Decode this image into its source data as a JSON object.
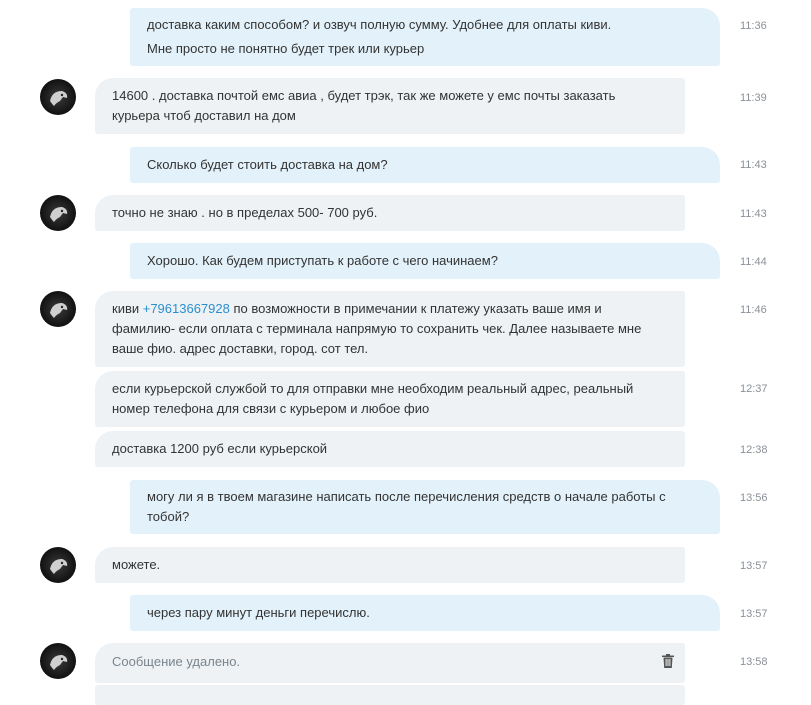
{
  "messages": [
    {
      "id": "m1",
      "dir": "out",
      "lines": [
        "доставка каким способом? и озвуч полную сумму. Удобнее для оплаты киви.",
        "Мне просто не понятно будет трек или курьер"
      ],
      "time": "11:36"
    },
    {
      "id": "m2",
      "dir": "in",
      "lines": [
        "14600 . доставка  почтой емс авиа , будет трэк, так же можете у емс почты заказать",
        "курьера чтоб доставил на дом"
      ],
      "time": "11:39"
    },
    {
      "id": "m3",
      "dir": "out",
      "lines": [
        "Сколько будет стоить доставка на дом?"
      ],
      "time": "11:43"
    },
    {
      "id": "m4",
      "dir": "in",
      "lines": [
        "точно не знаю . но в пределах  500- 700 руб."
      ],
      "time": "11:43"
    },
    {
      "id": "m5",
      "dir": "out",
      "lines": [
        "Хорошо. Как будем приступать к работе с чего начинаем?"
      ],
      "time": "11:44"
    },
    {
      "id": "m6",
      "dir": "in",
      "line1_prefix": "киви ",
      "phone": "+79613667928",
      "line1_suffix": "  по возможности в примечании к платежу указать ваше имя и",
      "lines": [
        "фамилию- если оплата с терминала напрямую то сохранить чек. Далее называете мне",
        "ваше фио. адрес доставки, город. сот тел."
      ],
      "time": "11:46"
    },
    {
      "id": "m7",
      "dir": "in",
      "lines": [
        "если курьерской службой то для отправки мне необходим реальный адрес, реальный",
        "номер телефона для связи с курьером и любое фио"
      ],
      "time": "12:37"
    },
    {
      "id": "m8",
      "dir": "in",
      "lines": [
        "доставка 1200 руб если курьерской"
      ],
      "time": "12:38"
    },
    {
      "id": "m9",
      "dir": "out",
      "lines": [
        "могу ли я в твоем магазине написать после перечисления средств о начале работы с",
        "тобой?"
      ],
      "time": "13:56"
    },
    {
      "id": "m10",
      "dir": "in",
      "lines": [
        "можете."
      ],
      "time": "13:57"
    },
    {
      "id": "m11",
      "dir": "out",
      "lines": [
        "через пару минут деньги перечислю."
      ],
      "time": "13:57"
    },
    {
      "id": "m12",
      "dir": "in",
      "deleted": true,
      "lines": [
        "Сообщение удалено."
      ],
      "time": "13:58",
      "icon": "trash-icon"
    }
  ],
  "colors": {
    "outgoing_bubble": "#e3f2fa",
    "incoming_bubble": "#eef2f5",
    "link": "#2b8fcf",
    "time": "#8a9199"
  }
}
